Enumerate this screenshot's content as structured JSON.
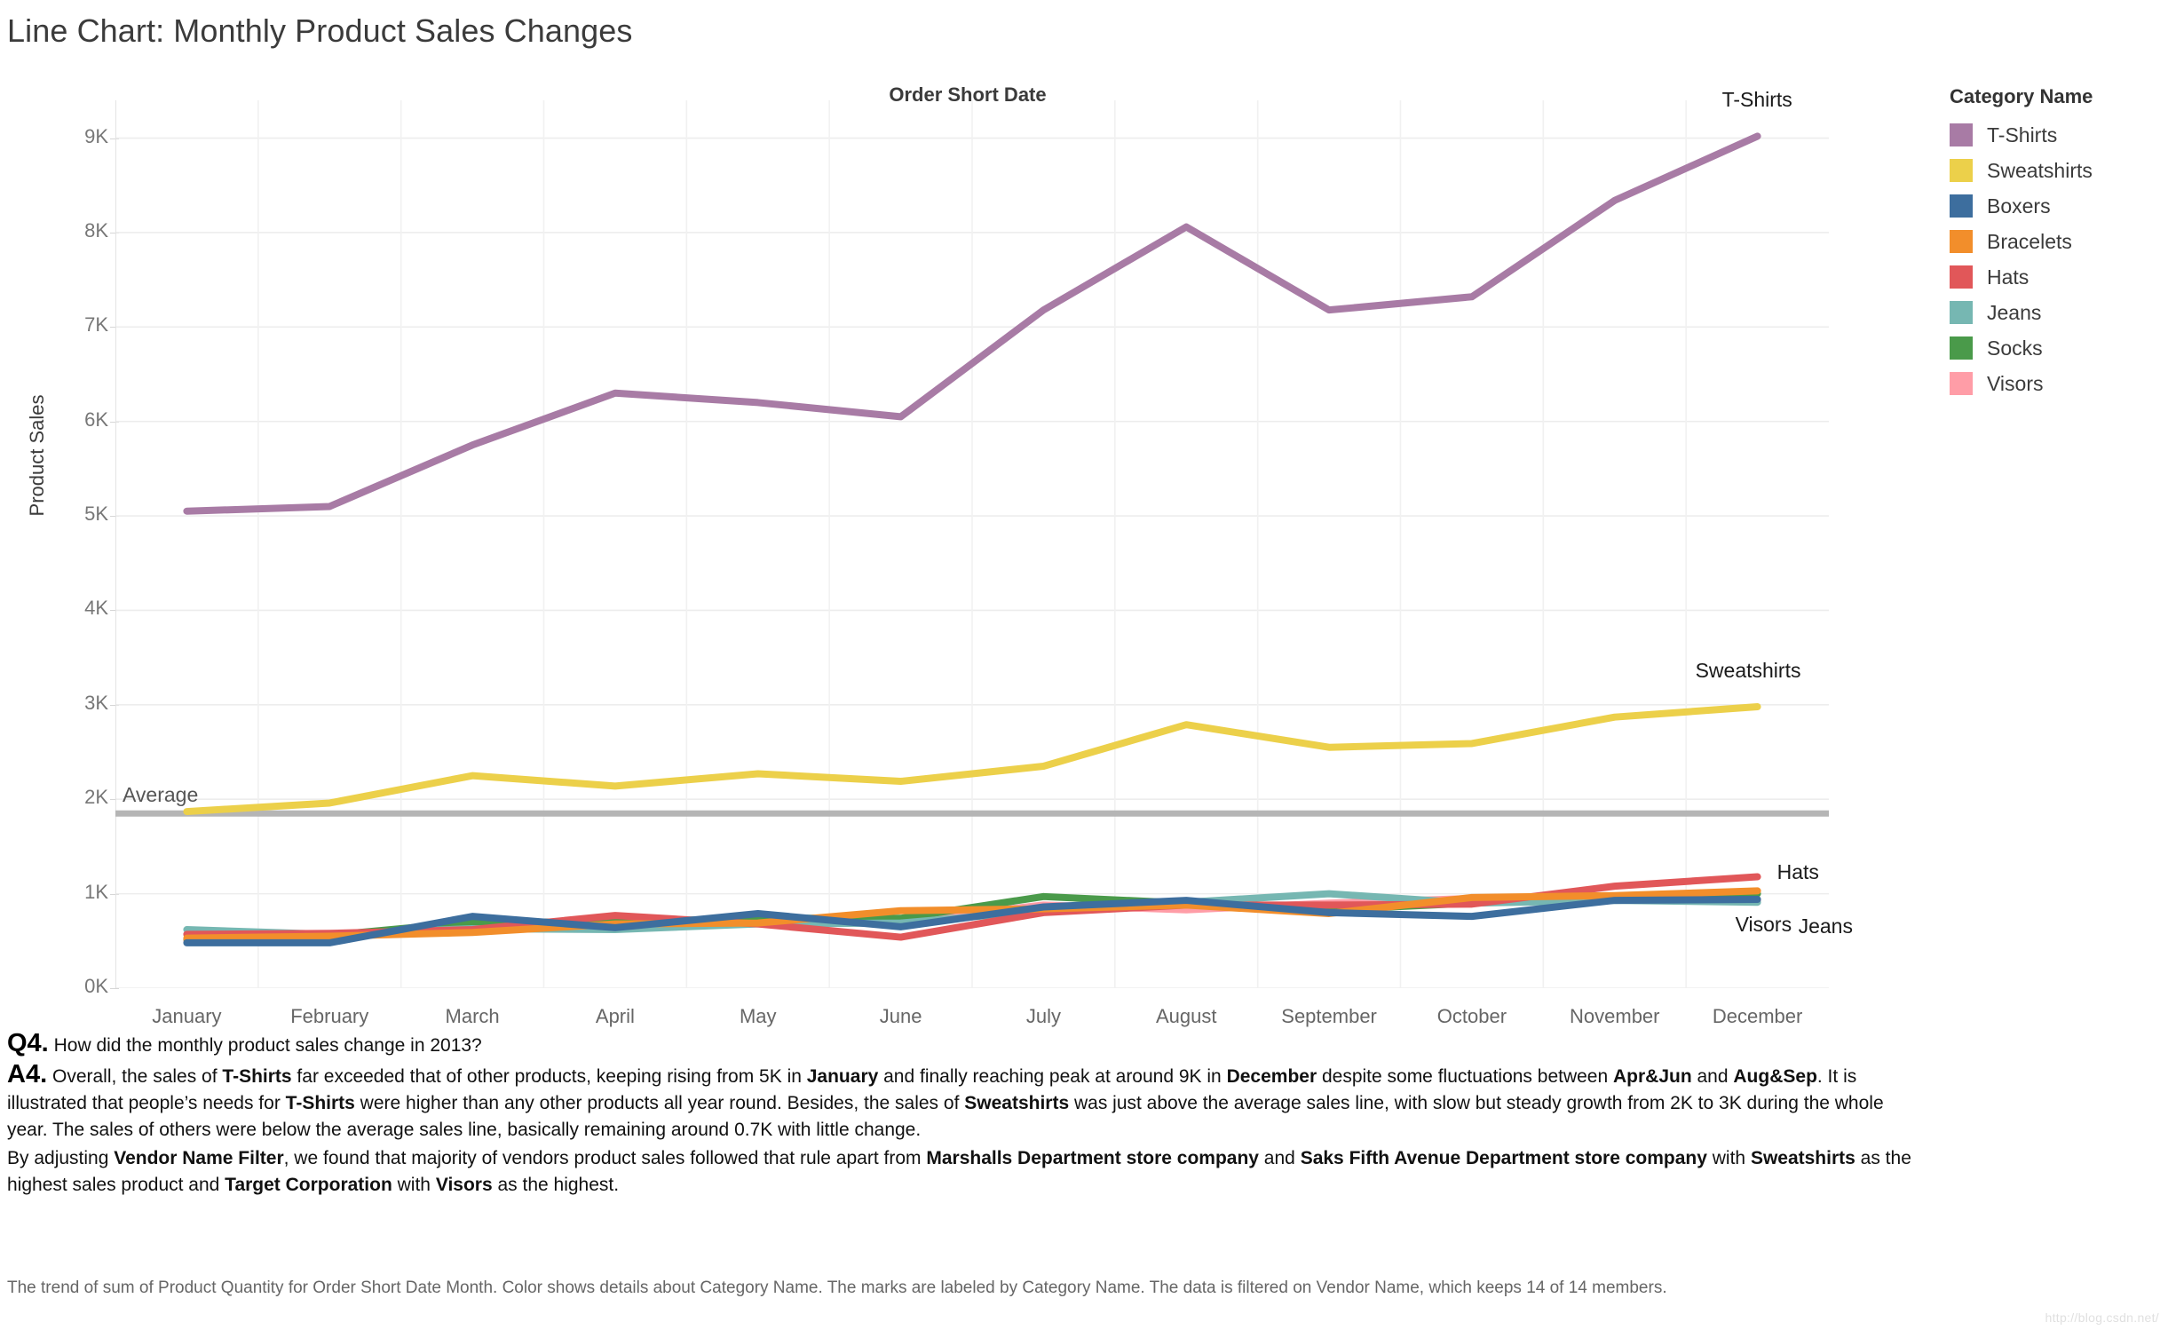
{
  "title": "Line Chart: Monthly Product Sales Changes",
  "axis": {
    "x_title": "Order Short Date",
    "y_title": "Product Sales"
  },
  "legend": {
    "title": "Category Name",
    "items": [
      {
        "label": "T-Shirts",
        "color": "#a87ba5"
      },
      {
        "label": "Sweatshirts",
        "color": "#ecd04a"
      },
      {
        "label": "Boxers",
        "color": "#3d6e9e"
      },
      {
        "label": "Bracelets",
        "color": "#f28e2b"
      },
      {
        "label": "Hats",
        "color": "#e15759"
      },
      {
        "label": "Jeans",
        "color": "#76b7b2"
      },
      {
        "label": "Socks",
        "color": "#4a9a4a"
      },
      {
        "label": "Visors",
        "color": "#ff9da7"
      }
    ]
  },
  "annotations": {
    "average_label": "Average",
    "series_end_labels": [
      {
        "text": "T-Shirts"
      },
      {
        "text": "Sweatshirts"
      },
      {
        "text": "Hats"
      },
      {
        "text": "Visors"
      },
      {
        "text": "Jeans"
      }
    ]
  },
  "qa": {
    "q_tag": "Q4.",
    "q_text": "How did the monthly product sales change in 2013?",
    "a_tag": "A4.",
    "a_text_1": "Overall, the sales of ",
    "a_b1": "T-Shirts",
    "a_text_2": " far exceeded that of other products, keeping rising from 5K in ",
    "a_b2": "January",
    "a_text_3": " and finally reaching peak at around 9K in ",
    "a_b3": "December",
    "a_text_4": " despite some fluctuations between ",
    "a_b4": "Apr&Jun",
    "a_text_5": " and ",
    "a_b5": "Aug&Sep",
    "a_text_6": ". It is illustrated that people’s needs for ",
    "a_b6": "T-Shirts",
    "a_text_7": " were higher than any other products all year round. Besides, the sales of ",
    "a_b7": "Sweatshirts",
    "a_text_8": " was just above the average sales line, with slow but steady growth from 2K to 3K during the whole year. The sales of others were below the average sales line, basically remaining around 0.7K with little change.",
    "a2_text_1": "By adjusting ",
    "a2_b1": "Vendor Name Filter",
    "a2_text_2": ", we found that majority of vendors product sales followed that rule apart from ",
    "a2_b2": "Marshalls Department store company",
    "a2_text_3": " and ",
    "a2_b3": "Saks Fifth Avenue Department store company",
    "a2_text_4": " with ",
    "a2_b4": "Sweatshirts",
    "a2_text_5": " as the highest sales product and ",
    "a2_b5": "Target Corporation",
    "a2_text_6": " with ",
    "a2_b6": "Visors",
    "a2_text_7": " as the highest."
  },
  "caption": "The trend of sum of Product Quantity for Order Short Date Month.  Color shows details about Category Name.  The marks are labeled by Category Name. The data is filtered on Vendor Name, which keeps 14 of 14 members.",
  "watermark": "http://blog.csdn.net/",
  "chart_data": {
    "type": "line",
    "title": "Line Chart: Monthly Product Sales Changes",
    "xlabel": "Order Short Date",
    "ylabel": "Product Sales",
    "categories": [
      "January",
      "February",
      "March",
      "April",
      "May",
      "June",
      "July",
      "August",
      "September",
      "October",
      "November",
      "December"
    ],
    "tick_labels_y": [
      "0K",
      "1K",
      "2K",
      "3K",
      "4K",
      "5K",
      "6K",
      "7K",
      "8K",
      "9K"
    ],
    "ylim": [
      0,
      9400
    ],
    "yticks": [
      0,
      1000,
      2000,
      3000,
      4000,
      5000,
      6000,
      7000,
      8000,
      9000
    ],
    "grid": true,
    "legend_position": "right",
    "reference_line": {
      "label": "Average",
      "value": 1850,
      "color": "#b5b5b5"
    },
    "series": [
      {
        "name": "T-Shirts",
        "color": "#a87ba5",
        "values": [
          5050,
          5100,
          5750,
          6300,
          6200,
          6050,
          7180,
          8060,
          7180,
          7320,
          8340,
          9020
        ]
      },
      {
        "name": "Sweatshirts",
        "color": "#ecd04a",
        "values": [
          1870,
          1960,
          2250,
          2140,
          2270,
          2190,
          2350,
          2790,
          2550,
          2590,
          2870,
          2980
        ]
      },
      {
        "name": "Boxers",
        "color": "#3d6e9e",
        "values": [
          480,
          480,
          760,
          640,
          790,
          650,
          860,
          930,
          800,
          760,
          930,
          940
        ]
      },
      {
        "name": "Bracelets",
        "color": "#f28e2b",
        "values": [
          530,
          550,
          590,
          680,
          690,
          820,
          840,
          880,
          790,
          960,
          980,
          1030
        ]
      },
      {
        "name": "Hats",
        "color": "#e15759",
        "values": [
          570,
          580,
          620,
          770,
          680,
          540,
          800,
          880,
          880,
          890,
          1080,
          1180
        ]
      },
      {
        "name": "Jeans",
        "color": "#76b7b2",
        "values": [
          620,
          570,
          630,
          620,
          680,
          690,
          820,
          910,
          1000,
          900,
          930,
          910
        ]
      },
      {
        "name": "Socks",
        "color": "#4a9a4a",
        "values": [
          520,
          560,
          700,
          700,
          740,
          740,
          970,
          900,
          830,
          900,
          960,
          1000
        ]
      },
      {
        "name": "Visors",
        "color": "#ff9da7",
        "values": [
          500,
          540,
          640,
          660,
          700,
          710,
          880,
          830,
          900,
          950,
          970,
          930
        ]
      }
    ]
  }
}
